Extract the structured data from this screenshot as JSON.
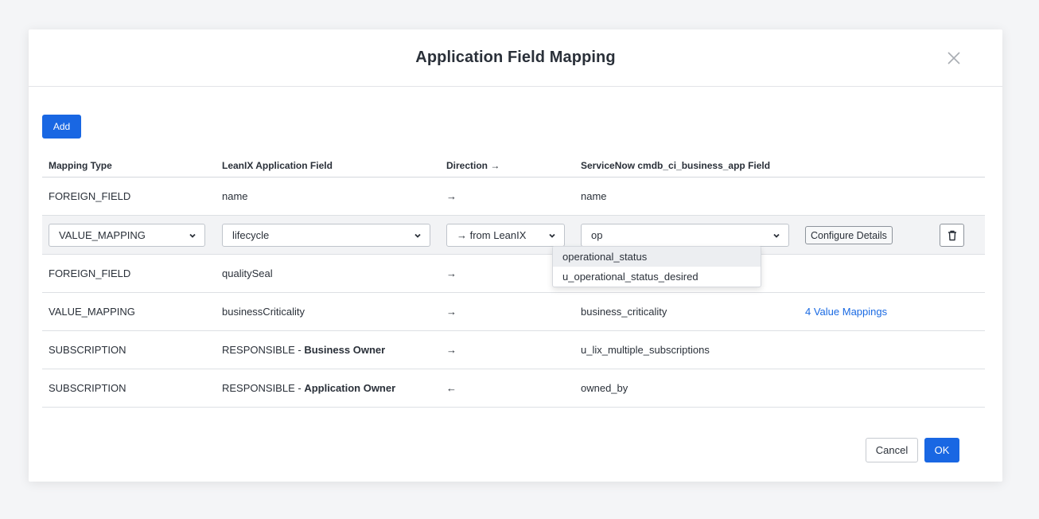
{
  "dialog": {
    "title": "Application Field Mapping",
    "add_label": "Add",
    "cancel_label": "Cancel",
    "ok_label": "OK"
  },
  "columns": {
    "mapping_type": "Mapping Type",
    "leanix_field": "LeanIX Application Field",
    "direction": "Direction →",
    "servicenow_field": "ServiceNow cmdb_ci_business_app Field"
  },
  "rows": [
    {
      "type": "FOREIGN_FIELD",
      "leanix": "name",
      "direction": "→",
      "servicenow": "name"
    },
    {
      "editing": true,
      "type": "VALUE_MAPPING",
      "leanix": "lifecycle",
      "direction": "→ from LeanIX",
      "servicenow": "op",
      "configure_label": "Configure Details"
    },
    {
      "type": "FOREIGN_FIELD",
      "leanix": "qualitySeal",
      "direction": "→",
      "servicenow": ""
    },
    {
      "type": "VALUE_MAPPING",
      "leanix": "businessCriticality",
      "direction": "→",
      "servicenow": "business_criticality",
      "extra": "4 Value Mappings"
    },
    {
      "type": "SUBSCRIPTION",
      "leanix_prefix": "RESPONSIBLE - ",
      "leanix_bold": "Business Owner",
      "direction": "→",
      "servicenow": "u_lix_multiple_subscriptions"
    },
    {
      "type": "SUBSCRIPTION",
      "leanix_prefix": "RESPONSIBLE - ",
      "leanix_bold": "Application Owner",
      "direction": "←",
      "servicenow": "owned_by"
    }
  ],
  "dropdown_options": [
    "operational_status",
    "u_operational_status_desired"
  ],
  "colors": {
    "primary": "#1967e3",
    "link": "#1a6ae3",
    "text": "#2a3039"
  },
  "icons": {
    "close": "close-icon",
    "chevron": "chevron-down-icon",
    "delete": "trash-icon"
  }
}
